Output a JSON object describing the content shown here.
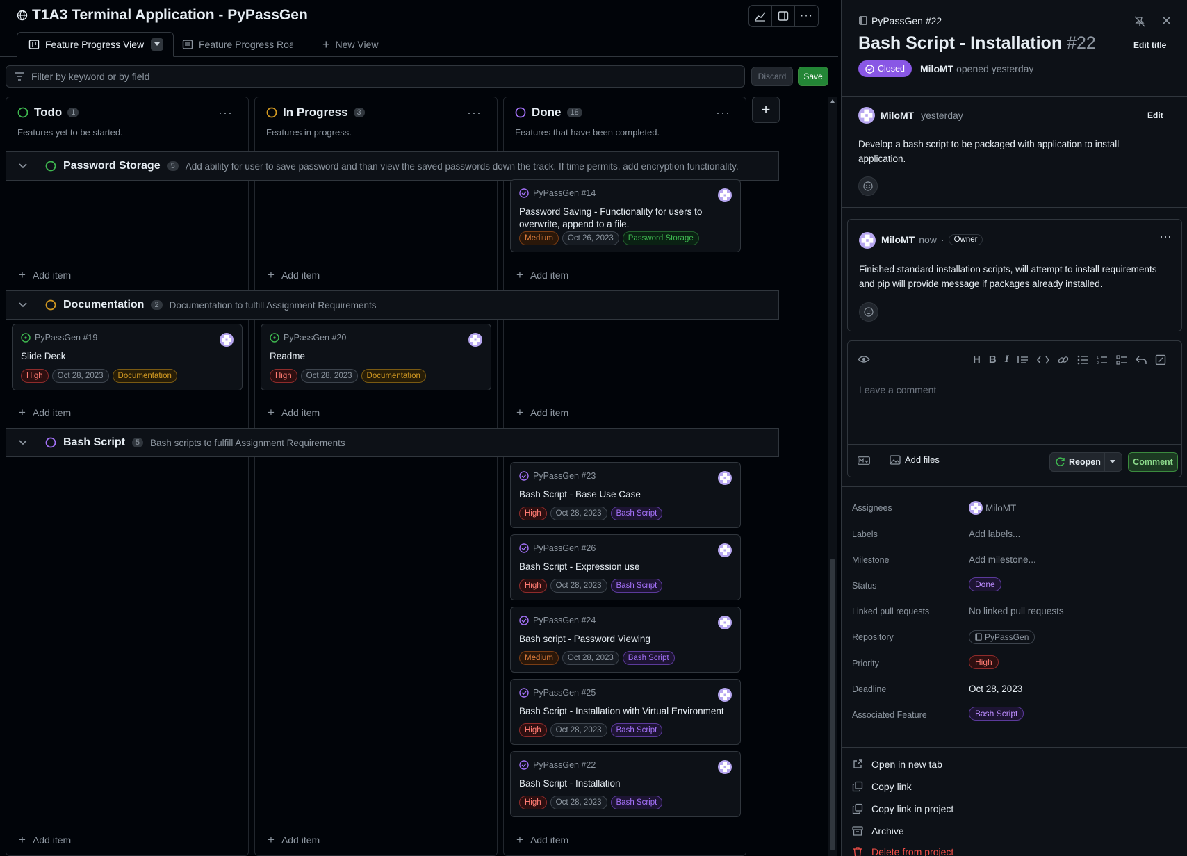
{
  "project": {
    "title": "T1A3 Terminal Application - PyPassGen",
    "tabs": [
      {
        "label": "Feature Progress View"
      },
      {
        "label": "Feature Progress Road"
      },
      {
        "label": "New View"
      }
    ]
  },
  "filter": {
    "placeholder": "Filter by keyword or by field",
    "discard_label": "Discard",
    "save_label": "Save"
  },
  "columns": [
    {
      "name": "Todo",
      "count": "1",
      "desc": "Features yet to be started.",
      "color": "#3fb950"
    },
    {
      "name": "In Progress",
      "count": "3",
      "desc": "Features in progress.",
      "color": "#d29922"
    },
    {
      "name": "Done",
      "count": "18",
      "desc": "Features that have been completed.",
      "color": "#a371f7"
    }
  ],
  "groups": [
    {
      "name": "Password Storage",
      "count": "5",
      "desc": "Add ability for user to save password and than view the saved passwords down the track. If time permits, add encryption functionality.",
      "color": "#3fb950"
    },
    {
      "name": "Documentation",
      "count": "2",
      "desc": "Documentation to fulfill Assignment Requirements",
      "color": "#d29922"
    },
    {
      "name": "Bash Script",
      "count": "5",
      "desc": "Bash scripts to fulfill Assignment Requirements",
      "color": "#a371f7"
    }
  ],
  "add_item_label": "Add item",
  "cards": {
    "c14": {
      "ref": "PyPassGen #14",
      "title": "Password Saving - Functionality for users to overwrite, append to a file.",
      "priority": "Medium",
      "date": "Oct 26, 2023",
      "feature": "Password Storage"
    },
    "c19": {
      "ref": "PyPassGen #19",
      "title": "Slide Deck",
      "priority": "High",
      "date": "Oct 28, 2023",
      "feature": "Documentation"
    },
    "c20": {
      "ref": "PyPassGen #20",
      "title": "Readme",
      "priority": "High",
      "date": "Oct 28, 2023",
      "feature": "Documentation"
    },
    "c23": {
      "ref": "PyPassGen #23",
      "title": "Bash Script - Base Use Case",
      "priority": "High",
      "date": "Oct 28, 2023",
      "feature": "Bash Script"
    },
    "c26": {
      "ref": "PyPassGen #26",
      "title": "Bash Script - Expression use",
      "priority": "High",
      "date": "Oct 28, 2023",
      "feature": "Bash Script"
    },
    "c24": {
      "ref": "PyPassGen #24",
      "title": "Bash script - Password Viewing",
      "priority": "Medium",
      "date": "Oct 28, 2023",
      "feature": "Bash Script"
    },
    "c25": {
      "ref": "PyPassGen #25",
      "title": "Bash Script - Installation with Virtual Environment",
      "priority": "High",
      "date": "Oct 28, 2023",
      "feature": "Bash Script"
    },
    "c22": {
      "ref": "PyPassGen #22",
      "title": "Bash Script - Installation",
      "priority": "High",
      "date": "Oct 28, 2023",
      "feature": "Bash Script"
    }
  },
  "panel": {
    "ref": "PyPassGen #22",
    "title": "Bash Script - Installation",
    "number": "#22",
    "edit_title": "Edit title",
    "state": "Closed",
    "author": "MiloMT",
    "opened": "opened yesterday",
    "comments": [
      {
        "author": "MiloMT",
        "time": "yesterday",
        "action": "Edit",
        "body": "Develop a bash script to be packaged with application to install application."
      },
      {
        "author": "MiloMT",
        "time": "now",
        "sep": "·",
        "badge": "Owner",
        "body": "Finished standard installation scripts, will attempt to install requirements and pip will provide message if packages already installed."
      }
    ],
    "comment_placeholder": "Leave a comment",
    "add_files": "Add files",
    "reopen": "Reopen",
    "comment_button": "Comment",
    "fields": {
      "assignees": {
        "key": "Assignees",
        "value": "MiloMT"
      },
      "labels": {
        "key": "Labels",
        "value": "Add labels..."
      },
      "milestone": {
        "key": "Milestone",
        "value": "Add milestone..."
      },
      "status": {
        "key": "Status",
        "value": "Done"
      },
      "linked_prs": {
        "key": "Linked pull requests",
        "value": "No linked pull requests"
      },
      "repository": {
        "key": "Repository",
        "value": "PyPassGen"
      },
      "priority": {
        "key": "Priority",
        "value": "High"
      },
      "deadline": {
        "key": "Deadline",
        "value": "Oct 28, 2023"
      },
      "feature": {
        "key": "Associated Feature",
        "value": "Bash Script"
      }
    },
    "actions": {
      "open_tab": "Open in new tab",
      "copy_link": "Copy link",
      "copy_link_project": "Copy link in project",
      "archive": "Archive",
      "delete": "Delete from project"
    }
  }
}
